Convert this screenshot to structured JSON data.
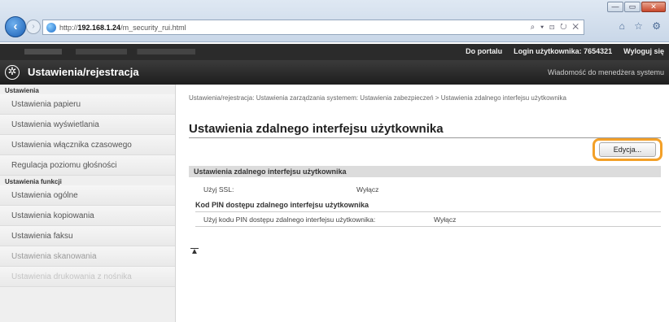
{
  "browser": {
    "url_prefix": "http://",
    "url_host": "192.168.1.24",
    "url_path": "/m_security_rui.html",
    "toolbar_glyphs": "⌕ ▾ ⊡ ↻ ✕",
    "right_glyphs": "⌂ ☆ ⚙",
    "window_buttons": [
      "—",
      "▭",
      "✕"
    ]
  },
  "topbar": {
    "portal_link": "Do portalu",
    "login_label": "Login użytkownika:",
    "login_value": "7654321",
    "logout_link": "Wyloguj się"
  },
  "titlebar": {
    "title": "Ustawienia/rejestracja",
    "admin_msg": "Wiadomość do menedżera systemu"
  },
  "sidebar": {
    "section1": "Ustawienia",
    "items1": [
      "Ustawienia papieru",
      "Ustawienia wyświetlania",
      "Ustawienia włącznika czasowego",
      "Regulacja poziomu głośności"
    ],
    "section2": "Ustawienia funkcji",
    "items2": [
      "Ustawienia ogólne",
      "Ustawienia kopiowania",
      "Ustawienia faksu",
      "Ustawienia skanowania",
      "Ustawienia drukowania z nośnika"
    ]
  },
  "main": {
    "breadcrumb": "Ustawienia/rejestracja: Ustawienia zarządzania systemem: Ustawienia zabezpieczeń > Ustawienia zdalnego interfejsu użytkownika",
    "title": "Ustawienia zdalnego interfejsu użytkownika",
    "edit_label": "Edycja...",
    "section_title": "Ustawienia zdalnego interfejsu użytkownika",
    "ssl_label": "Użyj SSL:",
    "ssl_value": "Wyłącz",
    "pin_heading": "Kod PIN dostępu zdalnego interfejsu użytkownika",
    "pin_label": "Użyj kodu PIN dostępu zdalnego interfejsu użytkownika:",
    "pin_value": "Wyłącz",
    "to_top_glyph": "▲"
  },
  "colors": {
    "highlight": "#f3a028",
    "topbar": "#2b2b2b"
  }
}
